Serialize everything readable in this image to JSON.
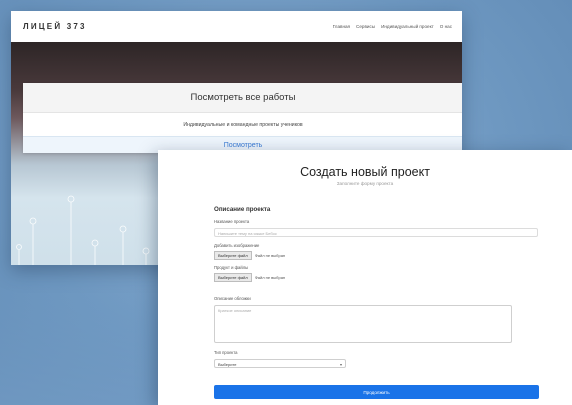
{
  "back_window": {
    "brand": "ЛИЦЕЙ 373",
    "nav_links": [
      "Главная",
      "Сервисы",
      "Индивидуальный проект",
      "О нас"
    ],
    "card": {
      "title": "Посмотреть все работы",
      "subtitle": "Индивидуальные и командные проекты учеников",
      "link_label": "Посмотреть"
    }
  },
  "front_window": {
    "title": "Создать новый проект",
    "subtitle": "Заполните форму проекта",
    "section_title": "Описание проекта",
    "fields": {
      "name_label": "Название проекта",
      "name_placeholder": "Напишите тему на языке Бебос",
      "cover_label": "Добавить изображение",
      "cover_button": "Выберите файл",
      "cover_status": "Файл не выбран",
      "project_file_label": "Продукт и файлы",
      "project_file_button": "Выберите файл",
      "project_file_status": "Файл не выбран",
      "description_label": "Описание обложки",
      "description_placeholder": "Краткое описание",
      "type_label": "Тип проекта",
      "type_value": "Выберите"
    },
    "submit_label": "Продолжить"
  },
  "colors": {
    "background": "#6d97bf",
    "accent": "#1a73e8",
    "link": "#3a7bd5"
  }
}
